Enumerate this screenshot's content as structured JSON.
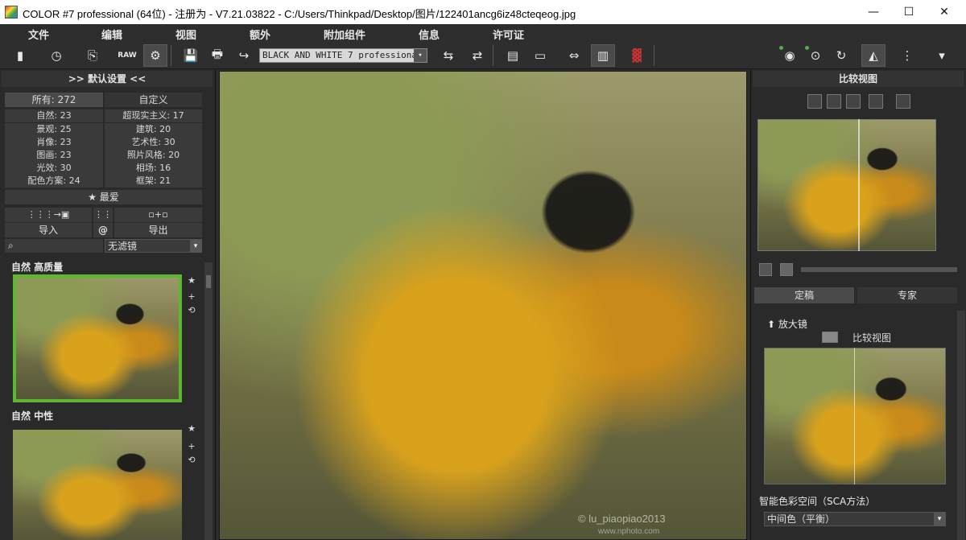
{
  "window": {
    "title": "COLOR #7 professional (64位) - 注册为 - V7.21.03822 - C:/Users/Thinkpad/Desktop/图片/122401ancg6iz48cteqeog.jpg",
    "controls": {
      "minimize": "—",
      "maximize": "☐",
      "close": "✕"
    }
  },
  "menu": [
    "文件",
    "编辑",
    "视图",
    "额外",
    "附加组件",
    "信息",
    "许可证"
  ],
  "toolbar": {
    "filter_value": "BLACK AND WHITE 7 professional",
    "raw_label": "RAW",
    "icons": {
      "new": "▮",
      "history": "◷",
      "copy": "⎘",
      "settings": "⚙",
      "save": "💾",
      "print": "🖶",
      "export": "↪",
      "compare_mode": "⇆",
      "transfer": "⇄",
      "film": "▤",
      "print2": "▭",
      "resize": "⇔",
      "bookmark": "▥",
      "histogram": "▓",
      "eye": "◉",
      "clock_eye": "⊙",
      "rotate": "↻",
      "split": "◭",
      "dots": "⋮",
      "arrow_down": "▾"
    }
  },
  "left": {
    "header": ">>  默认设置  <<",
    "tabs": {
      "all": "所有: 272",
      "custom": "自定义"
    },
    "categories": [
      [
        "自然: 23",
        "超现实主义: 17"
      ],
      [
        "景观: 25",
        "建筑: 20"
      ],
      [
        "肖像: 23",
        "艺术性: 30"
      ],
      [
        "图画: 23",
        "照片风格: 20"
      ],
      [
        "光效: 30",
        "相场: 16"
      ],
      [
        "配色方案: 24",
        "框架: 21"
      ]
    ],
    "favorites": "★ 最爱",
    "import_label": "导入",
    "at_label": "@",
    "export_label": "导出",
    "filter_placeholder": "无滤镜",
    "presets": [
      {
        "label": "自然  高质量"
      },
      {
        "label": "自然  中性"
      }
    ]
  },
  "right": {
    "header": "比较视图",
    "tabs": {
      "finished": "定稿",
      "expert": "专家"
    },
    "magnifier": "放大镜",
    "compare_label": "比较视图",
    "sca_label": "智能色彩空间（SCA方法）",
    "sca_value": "中间色（平衡）"
  },
  "main": {
    "watermark": "© lu_piaopiao2013",
    "watermark2": "www.nphoto.com"
  },
  "colors": {
    "selected_border": "#5cb830",
    "bg": "#2b2b2b",
    "accent_green": "#4caf50"
  }
}
